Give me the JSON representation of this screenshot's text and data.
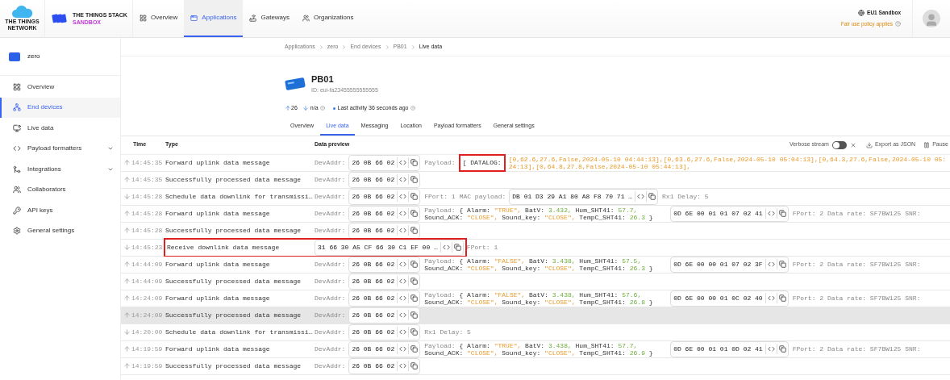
{
  "brand": {
    "network_line1": "THE THINGS",
    "network_line2": "NETWORK",
    "stack": "THE THINGS STACK",
    "sandbox": "SANDBOX"
  },
  "top_nav": [
    {
      "label": "Overview",
      "selected": false
    },
    {
      "label": "Applications",
      "selected": true
    },
    {
      "label": "Gateways",
      "selected": false
    },
    {
      "label": "Organizations",
      "selected": false
    }
  ],
  "cluster": {
    "name": "EU1 Sandbox",
    "policy": "Fair use policy applies"
  },
  "application": {
    "name": "zero"
  },
  "sidebar": [
    {
      "label": "Overview",
      "kind": "link",
      "selected": false
    },
    {
      "label": "End devices",
      "kind": "link",
      "selected": true
    },
    {
      "label": "Live data",
      "kind": "link",
      "selected": false
    },
    {
      "label": "Payload formatters",
      "kind": "group",
      "selected": false
    },
    {
      "label": "Integrations",
      "kind": "group",
      "selected": false
    },
    {
      "label": "Collaborators",
      "kind": "link",
      "selected": false
    },
    {
      "label": "API keys",
      "kind": "link",
      "selected": false
    },
    {
      "label": "General settings",
      "kind": "link",
      "selected": false
    }
  ],
  "breadcrumbs": [
    "Applications",
    "zero",
    "End devices",
    "PB01",
    "Live data"
  ],
  "device": {
    "name": "PB01",
    "id": "ID: eui-fa23455555555555",
    "uplinks": "26",
    "downlinks": "n/a",
    "last_activity": "Last activity 36 seconds ago"
  },
  "device_tabs": [
    {
      "label": "Overview",
      "selected": false
    },
    {
      "label": "Live data",
      "selected": true
    },
    {
      "label": "Messaging",
      "selected": false
    },
    {
      "label": "Location",
      "selected": false
    },
    {
      "label": "Payload formatters",
      "selected": false
    },
    {
      "label": "General settings",
      "selected": false
    }
  ],
  "table": {
    "columns": [
      "Time",
      "Type",
      "Data preview"
    ],
    "verbose_label": "Verbose stream",
    "verbose_on": false,
    "export": "Export as JSON",
    "pause": "Pause",
    "rows": [
      {
        "kind": "uplink",
        "time": "14:45:35",
        "type": "Forward uplink data message",
        "highlighted": false,
        "hovered": false,
        "parts": [
          {
            "kind": "chip",
            "label": "DevAddr:",
            "value": "26 0B 66 02"
          },
          {
            "kind": "datalog",
            "label": "Payload:",
            "tag": "[ DATALOG:",
            "value": "[0,62.6,27.6,False,2024-05-10 04:44:13],[0,63.6,27.6,False,2024-05-10 05:04:13],[0,64.3,27.6,False,2024-05-10 05:24:13],[0,64.8,27.8,False,2024-05-10 05:44:13],",
            "highlighted": true
          }
        ]
      },
      {
        "kind": "uplink",
        "time": "14:45:35",
        "type": "Successfully processed data message",
        "highlighted": false,
        "hovered": false,
        "parts": [
          {
            "kind": "chip",
            "label": "DevAddr:",
            "value": "26 0B 66 02"
          }
        ]
      },
      {
        "kind": "downlink",
        "time": "14:45:28",
        "type": "Schedule data downlink for transmissi…",
        "highlighted": false,
        "hovered": false,
        "parts": [
          {
            "kind": "chip",
            "label": "DevAddr:",
            "value": "26 0B 66 02"
          },
          {
            "kind": "text",
            "value": "FPort: 1"
          },
          {
            "kind": "chip",
            "label": "MAC payload:",
            "value": "DB 01 D3 29 A1 80 A8 F8 70 71 …"
          },
          {
            "kind": "text",
            "value": "Rx1 Delay: 5"
          }
        ]
      },
      {
        "kind": "uplink",
        "time": "14:45:28",
        "type": "Forward uplink data message",
        "highlighted": false,
        "hovered": false,
        "parts": [
          {
            "kind": "chip",
            "label": "DevAddr:",
            "value": "26 0B 66 02"
          },
          {
            "kind": "payload",
            "label": "Payload:",
            "open": "{",
            "close": "}",
            "fields": [
              {
                "key": "Alarm:",
                "value": "\"TRUE\",",
                "kind": "string"
              },
              {
                "key": "BatV:",
                "value": "3.432,",
                "kind": "number"
              },
              {
                "key": "Hum_SHT41:",
                "value": "57.7,",
                "kind": "number"
              },
              {
                "key": "Sound_ACK:",
                "value": "\"CLOSE\",",
                "kind": "string"
              },
              {
                "key": "Sound_key:",
                "value": "\"CLOSE\",",
                "kind": "string"
              },
              {
                "key": "TempC_SHT41:",
                "value": "26.3",
                "kind": "number"
              }
            ]
          },
          {
            "kind": "chip",
            "value": "0D 6E 00 01 01 07 02 41"
          },
          {
            "kind": "text",
            "value": "FPort: 2"
          },
          {
            "kind": "text",
            "value": "Data rate: SF7BW125"
          },
          {
            "kind": "text",
            "value": "SNR:"
          }
        ]
      },
      {
        "kind": "uplink",
        "time": "14:45:28",
        "type": "Successfully processed data message",
        "highlighted": false,
        "hovered": false,
        "parts": [
          {
            "kind": "chip",
            "label": "DevAddr:",
            "value": "26 0B 66 02"
          }
        ]
      },
      {
        "kind": "downlink",
        "time": "14:45:23",
        "type": "Receive downlink data message",
        "highlighted": true,
        "hovered": false,
        "parts": [
          {
            "kind": "chip",
            "value": "31 66 30 A5 CF 66 30 C1 EF 00 …"
          },
          {
            "kind": "text",
            "value": "FPort: 1"
          }
        ]
      },
      {
        "kind": "uplink",
        "time": "14:44:09",
        "type": "Forward uplink data message",
        "highlighted": false,
        "hovered": false,
        "parts": [
          {
            "kind": "chip",
            "label": "DevAddr:",
            "value": "26 0B 66 02"
          },
          {
            "kind": "payload",
            "label": "Payload:",
            "open": "{",
            "close": "}",
            "fields": [
              {
                "key": "Alarm:",
                "value": "\"FALSE\",",
                "kind": "string"
              },
              {
                "key": "BatV:",
                "value": "3.438,",
                "kind": "number"
              },
              {
                "key": "Hum_SHT41:",
                "value": "57.5,",
                "kind": "number"
              },
              {
                "key": "Sound_ACK:",
                "value": "\"CLOSE\",",
                "kind": "string"
              },
              {
                "key": "Sound_key:",
                "value": "\"CLOSE\",",
                "kind": "string"
              },
              {
                "key": "TempC_SHT41:",
                "value": "26.3",
                "kind": "number"
              }
            ]
          },
          {
            "kind": "chip",
            "value": "0D 6E 00 00 01 07 02 3F"
          },
          {
            "kind": "text",
            "value": "FPort: 2"
          },
          {
            "kind": "text",
            "value": "Data rate: SF7BW125"
          },
          {
            "kind": "text",
            "value": "SNR:"
          }
        ]
      },
      {
        "kind": "uplink",
        "time": "14:44:09",
        "type": "Successfully processed data message",
        "highlighted": false,
        "hovered": false,
        "parts": [
          {
            "kind": "chip",
            "label": "DevAddr:",
            "value": "26 0B 66 02"
          }
        ]
      },
      {
        "kind": "uplink",
        "time": "14:24:09",
        "type": "Forward uplink data message",
        "highlighted": false,
        "hovered": false,
        "parts": [
          {
            "kind": "chip",
            "label": "DevAddr:",
            "value": "26 0B 66 02"
          },
          {
            "kind": "payload",
            "label": "Payload:",
            "open": "{",
            "close": "}",
            "fields": [
              {
                "key": "Alarm:",
                "value": "\"FALSE\",",
                "kind": "string"
              },
              {
                "key": "BatV:",
                "value": "3.438,",
                "kind": "number"
              },
              {
                "key": "Hum_SHT41:",
                "value": "57.6,",
                "kind": "number"
              },
              {
                "key": "Sound_ACK:",
                "value": "\"CLOSE\",",
                "kind": "string"
              },
              {
                "key": "Sound_key:",
                "value": "\"CLOSE\",",
                "kind": "string"
              },
              {
                "key": "TempC_SHT41:",
                "value": "26.8",
                "kind": "number"
              }
            ]
          },
          {
            "kind": "chip",
            "value": "0D 6E 00 00 01 0C 02 40"
          },
          {
            "kind": "text",
            "value": "FPort: 2"
          },
          {
            "kind": "text",
            "value": "Data rate: SF7BW125"
          },
          {
            "kind": "text",
            "value": "SNR:"
          }
        ]
      },
      {
        "kind": "uplink",
        "time": "14:24:09",
        "type": "Successfully processed data message",
        "highlighted": false,
        "hovered": true,
        "parts": [
          {
            "kind": "chip",
            "label": "DevAddr:",
            "value": "26 0B 66 02"
          }
        ]
      },
      {
        "kind": "downlink",
        "time": "14:20:00",
        "type": "Schedule data downlink for transmissi…",
        "highlighted": false,
        "hovered": false,
        "parts": [
          {
            "kind": "chip",
            "label": "DevAddr:",
            "value": "26 0B 66 02"
          },
          {
            "kind": "text",
            "value": "Rx1 Delay: 5"
          }
        ]
      },
      {
        "kind": "uplink",
        "time": "14:19:59",
        "type": "Forward uplink data message",
        "highlighted": false,
        "hovered": false,
        "parts": [
          {
            "kind": "chip",
            "label": "DevAddr:",
            "value": "26 0B 66 02"
          },
          {
            "kind": "payload",
            "label": "Payload:",
            "open": "{",
            "close": "}",
            "fields": [
              {
                "key": "Alarm:",
                "value": "\"TRUE\",",
                "kind": "string"
              },
              {
                "key": "BatV:",
                "value": "3.438,",
                "kind": "number"
              },
              {
                "key": "Hum_SHT41:",
                "value": "57.7,",
                "kind": "number"
              },
              {
                "key": "Sound_ACK:",
                "value": "\"CLOSE\",",
                "kind": "string"
              },
              {
                "key": "Sound_key:",
                "value": "\"CLOSE\",",
                "kind": "string"
              },
              {
                "key": "TempC_SHT41:",
                "value": "26.9",
                "kind": "number"
              }
            ]
          },
          {
            "kind": "chip",
            "value": "0D 6E 00 01 01 0D 02 41"
          },
          {
            "kind": "text",
            "value": "FPort: 2"
          },
          {
            "kind": "text",
            "value": "Data rate: SF7BW125"
          },
          {
            "kind": "text",
            "value": "SNR:"
          }
        ]
      },
      {
        "kind": "uplink",
        "time": "14:19:59",
        "type": "Successfully processed data message",
        "highlighted": false,
        "hovered": false,
        "parts": [
          {
            "kind": "chip",
            "label": "DevAddr:",
            "value": "26 0B 66 02"
          }
        ]
      }
    ]
  }
}
